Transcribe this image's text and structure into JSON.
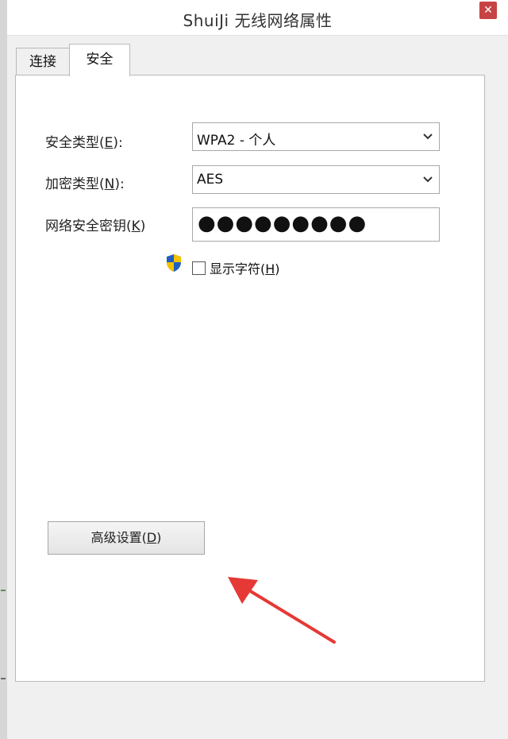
{
  "window": {
    "title": "ShuiJi 无线网络属性",
    "close_glyph": "✕"
  },
  "tabs": [
    {
      "label": "连接",
      "selected": false
    },
    {
      "label": "安全",
      "selected": true
    }
  ],
  "security": {
    "type_label_pre": "安全类型(",
    "type_label_key": "E",
    "type_label_post": "):",
    "type_value": "WPA2 - 个人",
    "enc_label_pre": "加密类型(",
    "enc_label_key": "N",
    "enc_label_post": "):",
    "enc_value": "AES",
    "key_label_pre": "网络安全密钥(",
    "key_label_key": "K",
    "key_label_post": ")",
    "key_value": "●●●●●●●●●",
    "show_chars_pre": "显示字符(",
    "show_chars_key": "H",
    "show_chars_post": ")",
    "show_chars_checked": false
  },
  "buttons": {
    "advanced_pre": "高级设置(",
    "advanced_key": "D",
    "advanced_post": ")"
  },
  "colors": {
    "annotation_arrow": "#e53935",
    "close_button": "#c74343",
    "shield_blue": "#1f5fbf",
    "shield_yellow": "#f2c200"
  },
  "icons": {
    "shield": "uac-shield-icon",
    "dropdown": "chevron-down-icon",
    "close": "close-icon"
  }
}
